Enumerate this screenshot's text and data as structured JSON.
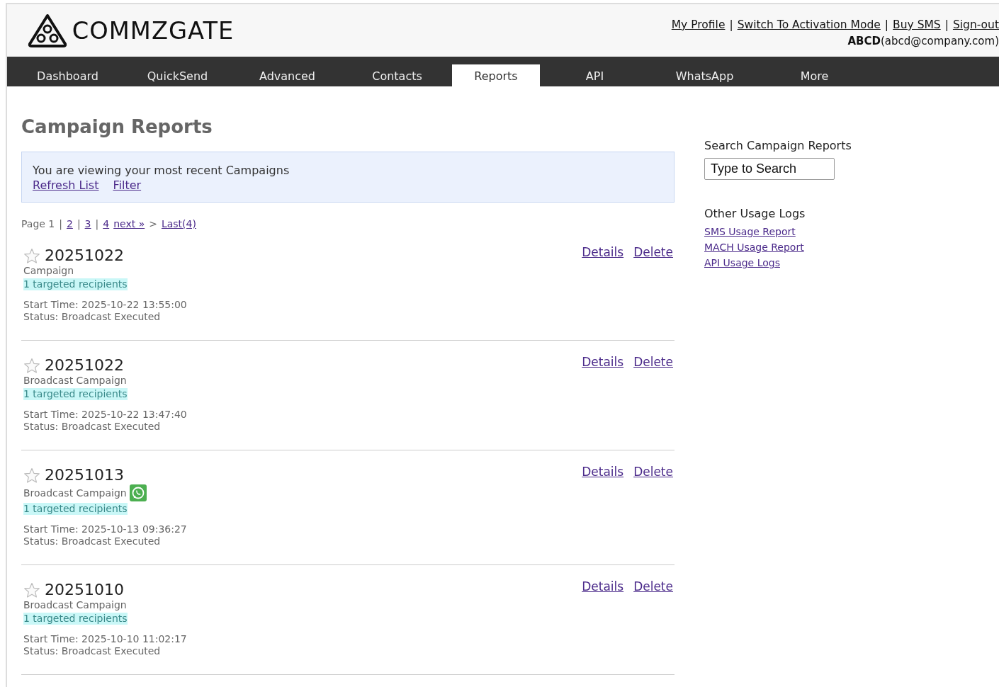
{
  "header": {
    "logo": "COMMZGATE",
    "links": [
      {
        "label": "My Profile"
      },
      {
        "label": "Switch To Activation Mode"
      },
      {
        "label": "Buy SMS"
      },
      {
        "label": "Sign-out"
      }
    ],
    "separators": [
      "|",
      "|",
      "|"
    ],
    "user": {
      "name": "ABCD",
      "email": "(abcd@company.com)"
    }
  },
  "nav": [
    {
      "label": "Dashboard",
      "selected": false
    },
    {
      "label": "QuickSend",
      "selected": false
    },
    {
      "label": "Advanced",
      "selected": false
    },
    {
      "label": "Contacts",
      "selected": false
    },
    {
      "label": "Reports",
      "selected": true
    },
    {
      "label": "API",
      "selected": false
    },
    {
      "label": "WhatsApp",
      "selected": false
    },
    {
      "label": "More",
      "selected": false
    }
  ],
  "page_title": "Campaign Reports",
  "notice": {
    "text": "You are viewing your most recent Campaigns",
    "links": [
      "Refresh List",
      "Filter"
    ]
  },
  "pagination": [
    {
      "kind": "text",
      "label": "Page 1"
    },
    {
      "kind": "text",
      "label": "|"
    },
    {
      "kind": "link",
      "label": "2"
    },
    {
      "kind": "text",
      "label": "|"
    },
    {
      "kind": "link",
      "label": "3"
    },
    {
      "kind": "text",
      "label": "|"
    },
    {
      "kind": "link",
      "label": "4"
    },
    {
      "kind": "link",
      "label": "next »"
    },
    {
      "kind": "text",
      "label": ">"
    },
    {
      "kind": "link",
      "label": "Last(4)"
    }
  ],
  "campaigns": [
    {
      "title": "20251022",
      "starred": false,
      "type": "Campaign",
      "whatsapp": false,
      "recipients": "1 targeted recipients",
      "start_time": "Start Time: 2025-10-22 13:55:00",
      "status": "Status: Broadcast Executed",
      "actions": [
        "Details",
        "Delete"
      ]
    },
    {
      "title": "20251022",
      "starred": false,
      "type": "Broadcast Campaign",
      "whatsapp": false,
      "recipients": "1 targeted recipients",
      "start_time": "Start Time: 2025-10-22 13:47:40",
      "status": "Status: Broadcast Executed",
      "actions": [
        "Details",
        "Delete"
      ]
    },
    {
      "title": "20251013",
      "starred": false,
      "type": "Broadcast Campaign",
      "whatsapp": true,
      "recipients": "1 targeted recipients",
      "start_time": "Start Time: 2025-10-13 09:36:27",
      "status": "Status: Broadcast Executed",
      "actions": [
        "Details",
        "Delete"
      ]
    },
    {
      "title": "20251010",
      "starred": false,
      "type": "Broadcast Campaign",
      "whatsapp": false,
      "recipients": "1 targeted recipients",
      "start_time": "Start Time: 2025-10-10 11:02:17",
      "status": "Status: Broadcast Executed",
      "actions": [
        "Details",
        "Delete"
      ]
    }
  ],
  "sidebar": {
    "search_title": "Search Campaign Reports",
    "search_placeholder": "Type to Search",
    "logs_title": "Other Usage Logs",
    "logs": [
      "SMS Usage Report",
      "MACH Usage Report",
      "API Usage Logs"
    ]
  }
}
